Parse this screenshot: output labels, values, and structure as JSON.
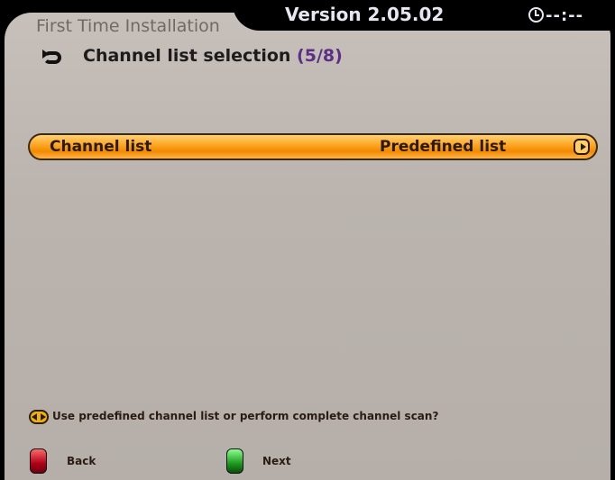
{
  "header": {
    "title": "First Time Installation",
    "version": "Version 2.05.02",
    "clock": "--:--"
  },
  "step": {
    "title": "Channel list selection",
    "count": "(5/8)"
  },
  "setting": {
    "label": "Channel list",
    "value": "Predefined list"
  },
  "hint": {
    "text": "Use predefined channel list or perform complete channel scan?"
  },
  "footer": {
    "back_label": "Back",
    "next_label": "Next"
  },
  "icons": {
    "clock": "clock-icon",
    "step": "step-arrow-icon",
    "row_arrow": "right-arrow-icon",
    "hint": "left-right-arrows-icon",
    "back": "red-key-icon",
    "next": "green-key-icon"
  },
  "colors": {
    "panel_bg": "#bbb4ae",
    "highlight": "#ffad2e",
    "step_count": "#5a2f85",
    "red_key": "#b00018",
    "green_key": "#1e9a1e"
  }
}
